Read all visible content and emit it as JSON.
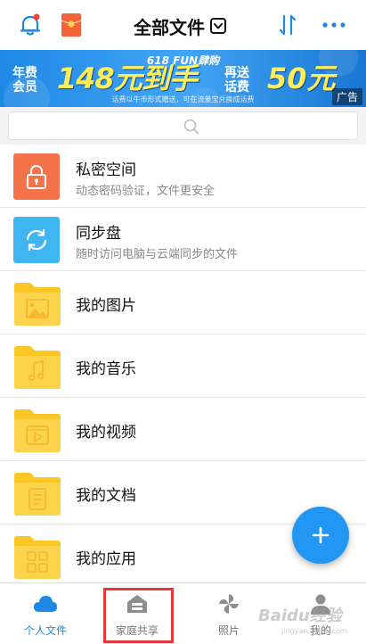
{
  "header": {
    "title": "全部文件",
    "icons": [
      "bell-icon",
      "red-packet-icon",
      "chevron-down-icon",
      "sort-icon",
      "more-icon"
    ],
    "accent": "#1e88e5"
  },
  "banner": {
    "top_text": "618 FUN肆购",
    "left_text_1": "年费",
    "left_text_2": "会员",
    "big_price": "148元到手",
    "mid_text_1": "再送",
    "mid_text_2": "话费",
    "right_text": "50元",
    "footnote": "话费以牛币形式赠送，可在流量宝兑换成话费",
    "ad_label": "广告"
  },
  "search": {
    "icon": "search-icon"
  },
  "items": [
    {
      "label": "私密空间",
      "sub": "动态密码验证，文件更安全",
      "icon": "lock-icon",
      "color": "#f4734b"
    },
    {
      "label": "同步盘",
      "sub": "随时访问电脑与云端同步的文件",
      "icon": "sync-icon",
      "color": "#3fb6f2"
    },
    {
      "label": "我的图片",
      "icon": "folder-image-icon",
      "color": "#fcd34d"
    },
    {
      "label": "我的音乐",
      "icon": "folder-music-icon",
      "color": "#fcd34d"
    },
    {
      "label": "我的视频",
      "icon": "folder-video-icon",
      "color": "#fcd34d"
    },
    {
      "label": "我的文档",
      "icon": "folder-document-icon",
      "color": "#fcd34d"
    },
    {
      "label": "我的应用",
      "icon": "folder-apps-icon",
      "color": "#fcd34d"
    }
  ],
  "fab": {
    "icon": "plus-icon",
    "color": "#2196f3"
  },
  "tabs": [
    {
      "label": "个人文件",
      "icon": "cloud-icon",
      "active": true
    },
    {
      "label": "家庭共享",
      "icon": "home-share-icon",
      "active": false
    },
    {
      "label": "照片",
      "icon": "pinwheel-icon",
      "active": false
    },
    {
      "label": "我的",
      "icon": "person-icon",
      "active": false
    }
  ],
  "highlight_color": "#e53935",
  "watermark": {
    "text": "Baidu经验",
    "sub": "jingyan.baidu.com"
  }
}
